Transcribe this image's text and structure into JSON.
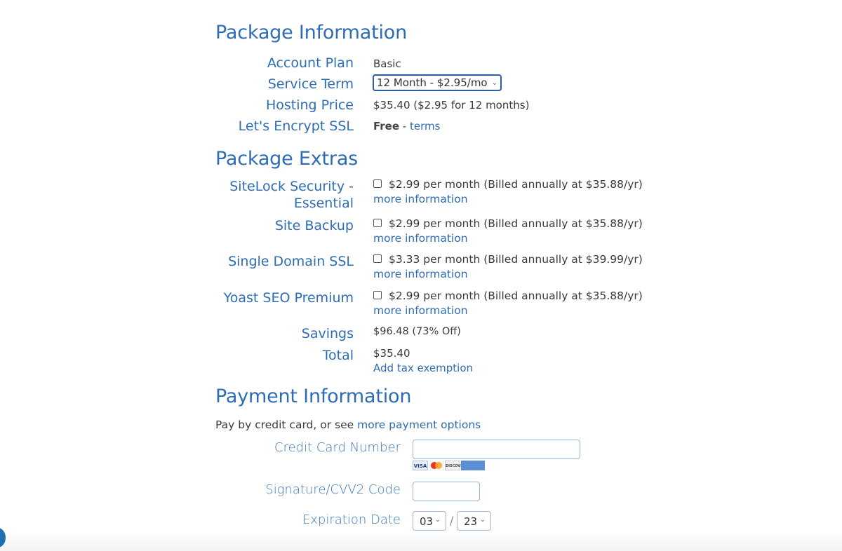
{
  "package_information": {
    "title": "Package Information",
    "rows": [
      {
        "label": "Account Plan",
        "value": "Basic"
      },
      {
        "label": "Service Term",
        "select_value": "12 Month - $2.95/mo"
      },
      {
        "label": "Hosting Price",
        "value": "$35.40 ($2.95 for 12 months)"
      },
      {
        "label": "Let's Encrypt SSL",
        "value_bold": "Free",
        "separator": " - ",
        "link": "terms"
      }
    ]
  },
  "package_extras": {
    "title": "Package Extras",
    "items": [
      {
        "label": "SiteLock Security - Essential",
        "checked": false,
        "price": "$2.99 per month (Billed annually at $35.88/yr)",
        "link": "more information"
      },
      {
        "label": "Site Backup",
        "checked": false,
        "price": "$2.99 per month (Billed annually at $35.88/yr)",
        "link": "more information"
      },
      {
        "label": "Single Domain SSL",
        "checked": false,
        "price": "$3.33 per month (Billed annually at $39.99/yr)",
        "link": "more information"
      },
      {
        "label": "Yoast SEO Premium",
        "checked": false,
        "price": "$2.99 per month (Billed annually at $35.88/yr)",
        "link": "more information"
      }
    ],
    "savings": {
      "label": "Savings",
      "value": "$96.48 (73% Off)"
    },
    "total": {
      "label": "Total",
      "value": "$35.40",
      "link": "Add tax exemption"
    }
  },
  "payment_information": {
    "title": "Payment Information",
    "intro_text": "Pay by credit card, or see ",
    "intro_link": "more payment options",
    "credit_card_label": "Credit Card Number",
    "credit_card_value": "",
    "card_icons": [
      "VISA",
      "MC",
      "DISCOVER",
      "AMEX"
    ],
    "cvv_label": "Signature/CVV2 Code",
    "cvv_value": "",
    "expiration_label": "Expiration Date",
    "expiration_month": "03",
    "expiration_separator": "/",
    "expiration_year": "23"
  },
  "colors": {
    "accent": "#2e6db4",
    "select_border": "#2b5ea3",
    "help_bubble": "#1e6fb6"
  }
}
